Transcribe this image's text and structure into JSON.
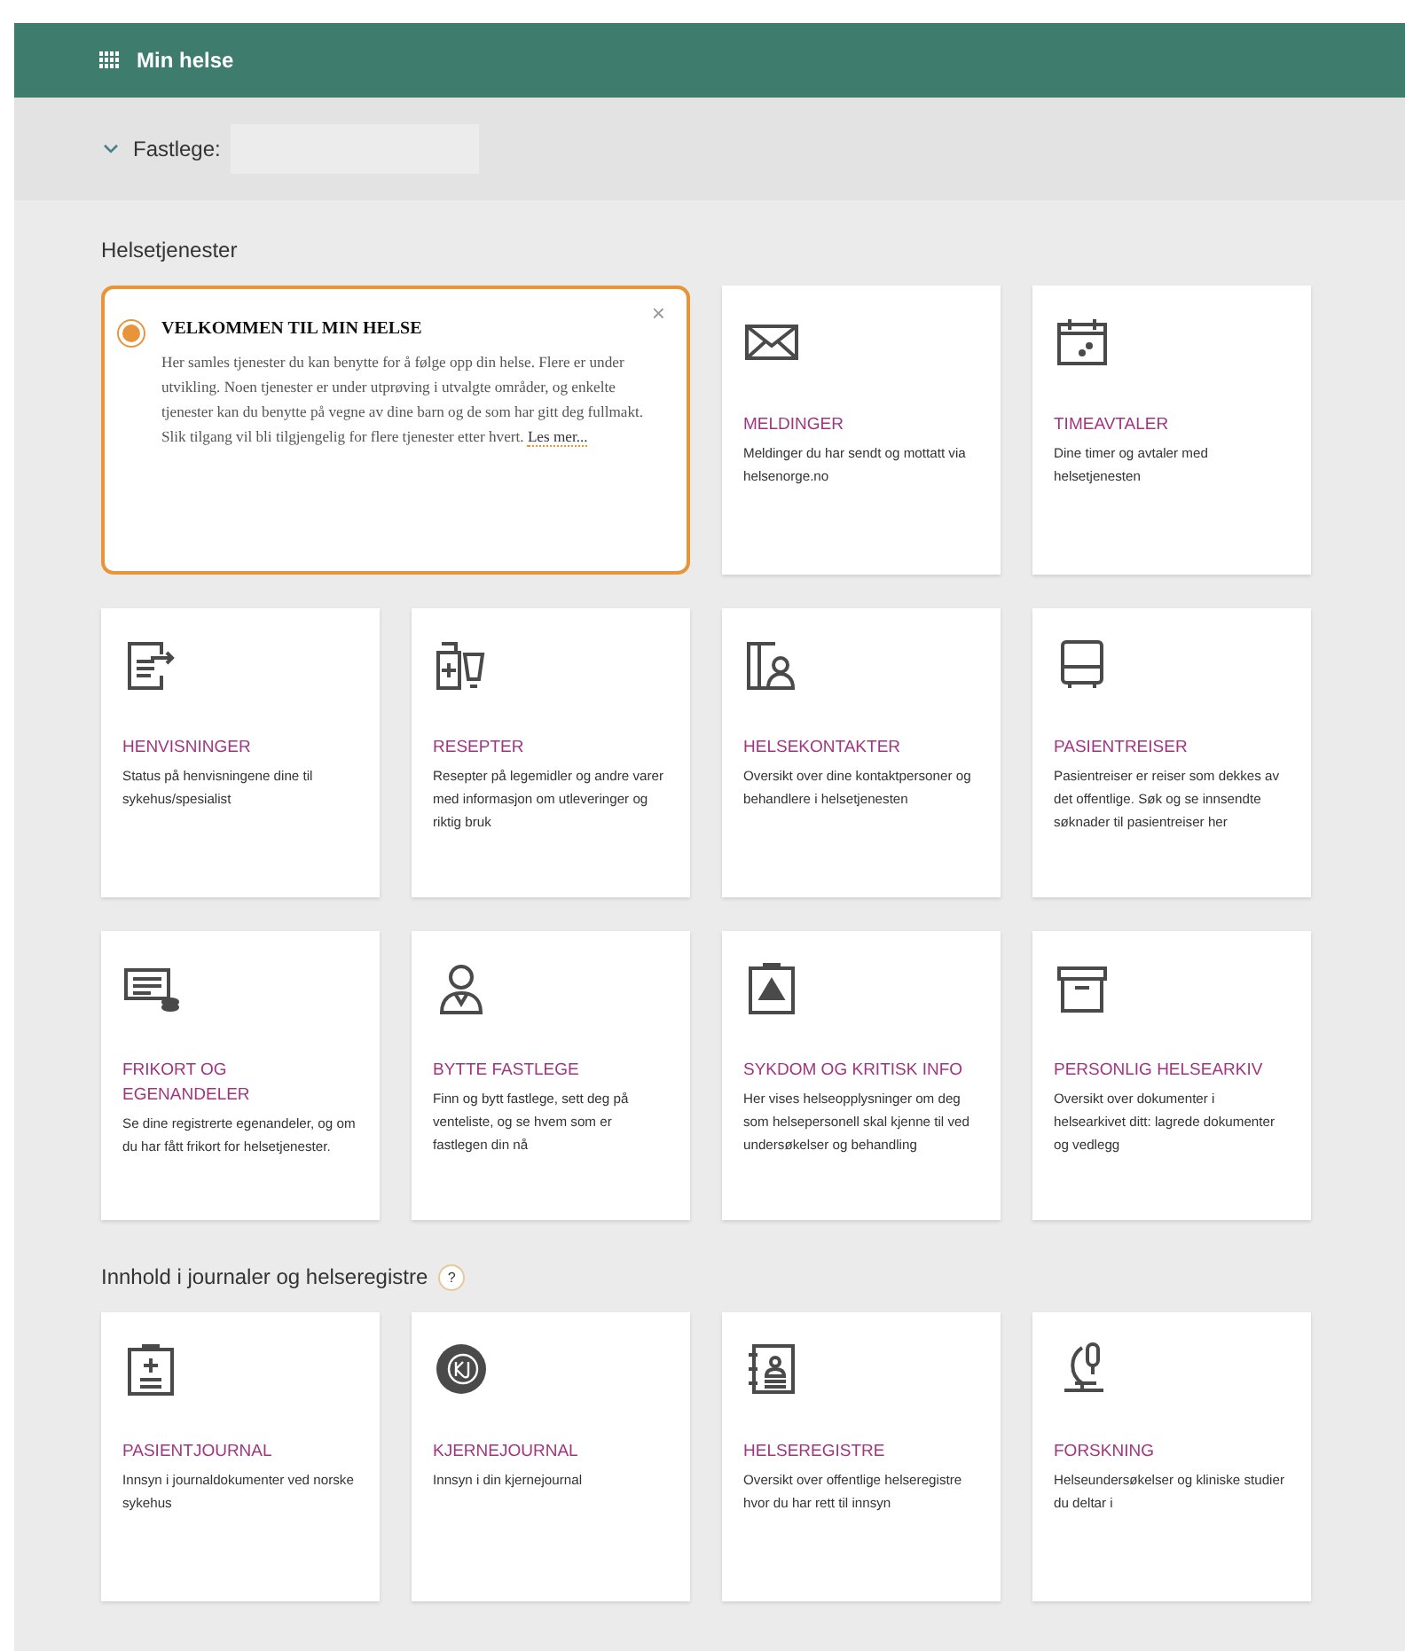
{
  "header": {
    "title": "Min helse"
  },
  "fastlege": {
    "label": "Fastlege:",
    "expanded": true
  },
  "sections": [
    {
      "title": "Helsetjenester",
      "welcome": {
        "title": "VELKOMMEN TIL MIN HELSE",
        "close": "×",
        "text": "Her samles tjenester du kan benytte for å følge opp din helse. Flere er under utvikling. Noen tjenester er under utprøving i utvalgte områder, og enkelte tjenester kan du benytte på vegne av dine barn og de som har gitt deg fullmakt. Slik tilgang vil bli tilgjengelig for flere tjenester etter hvert.",
        "link": "Les mer..."
      },
      "cards": [
        {
          "kind": "envelope",
          "title": "MELDINGER",
          "text": "Meldinger du har sendt og mottatt via helsenorge.no"
        },
        {
          "kind": "calendar",
          "title": "TIMEAVTALER",
          "text": "Dine timer og avtaler med helsetjenesten"
        },
        {
          "kind": "document",
          "title": "HENVISNINGER",
          "text": "Status på henvisningene dine til sykehus/spesialist"
        },
        {
          "kind": "medicine",
          "title": "RESEPTER",
          "text": "Resepter på legemidler og andre varer med informasjon om utleveringer og riktig bruk"
        },
        {
          "kind": "contact",
          "title": "HELSEKONTAKTER",
          "text": "Oversikt over dine kontaktpersoner og behandlere i helsetjenesten"
        },
        {
          "kind": "bus",
          "title": "PASIENTREISER",
          "text": "Pasientreiser er reiser som dekkes av det offentlige. Søk og se innsendte søknader til pasientreiser her"
        },
        {
          "kind": "card",
          "title": "FRIKORT OG EGENANDELER",
          "text": "Se dine registrerte egenandeler, og om du har fått frikort for helsetjenester."
        },
        {
          "kind": "person",
          "title": "BYTTE FASTLEGE",
          "text": "Finn og bytt fastlege, sett deg på venteliste, og se hvem som er fastlegen din nå"
        },
        {
          "kind": "warning",
          "title": "SYKDOM OG KRITISK INFO",
          "text": "Her vises helseopplysninger om deg som helsepersonell skal kjenne til ved undersøkelser og behandling"
        },
        {
          "kind": "archive",
          "title": "PERSONLIG HELSEARKIV",
          "text": "Oversikt over dokumenter i helsearkivet ditt: lagrede dokumenter og vedlegg"
        }
      ]
    },
    {
      "title": "Innhold i journaler og helseregistre",
      "help": "?",
      "cards": [
        {
          "kind": "clipboard",
          "title": "PASIENTJOURNAL",
          "text": "Innsyn i journaldokumenter ved norske sykehus"
        },
        {
          "kind": "kj",
          "title": "KJERNEJOURNAL",
          "text": "Innsyn i din kjernejournal"
        },
        {
          "kind": "register",
          "title": "HELSEREGISTRE",
          "text": "Oversikt over offentlige helseregistre hvor du har rett til innsyn"
        },
        {
          "kind": "microscope",
          "title": "FORSKNING",
          "text": "Helseundersøkelser og kliniske studier du deltar i"
        }
      ]
    }
  ]
}
